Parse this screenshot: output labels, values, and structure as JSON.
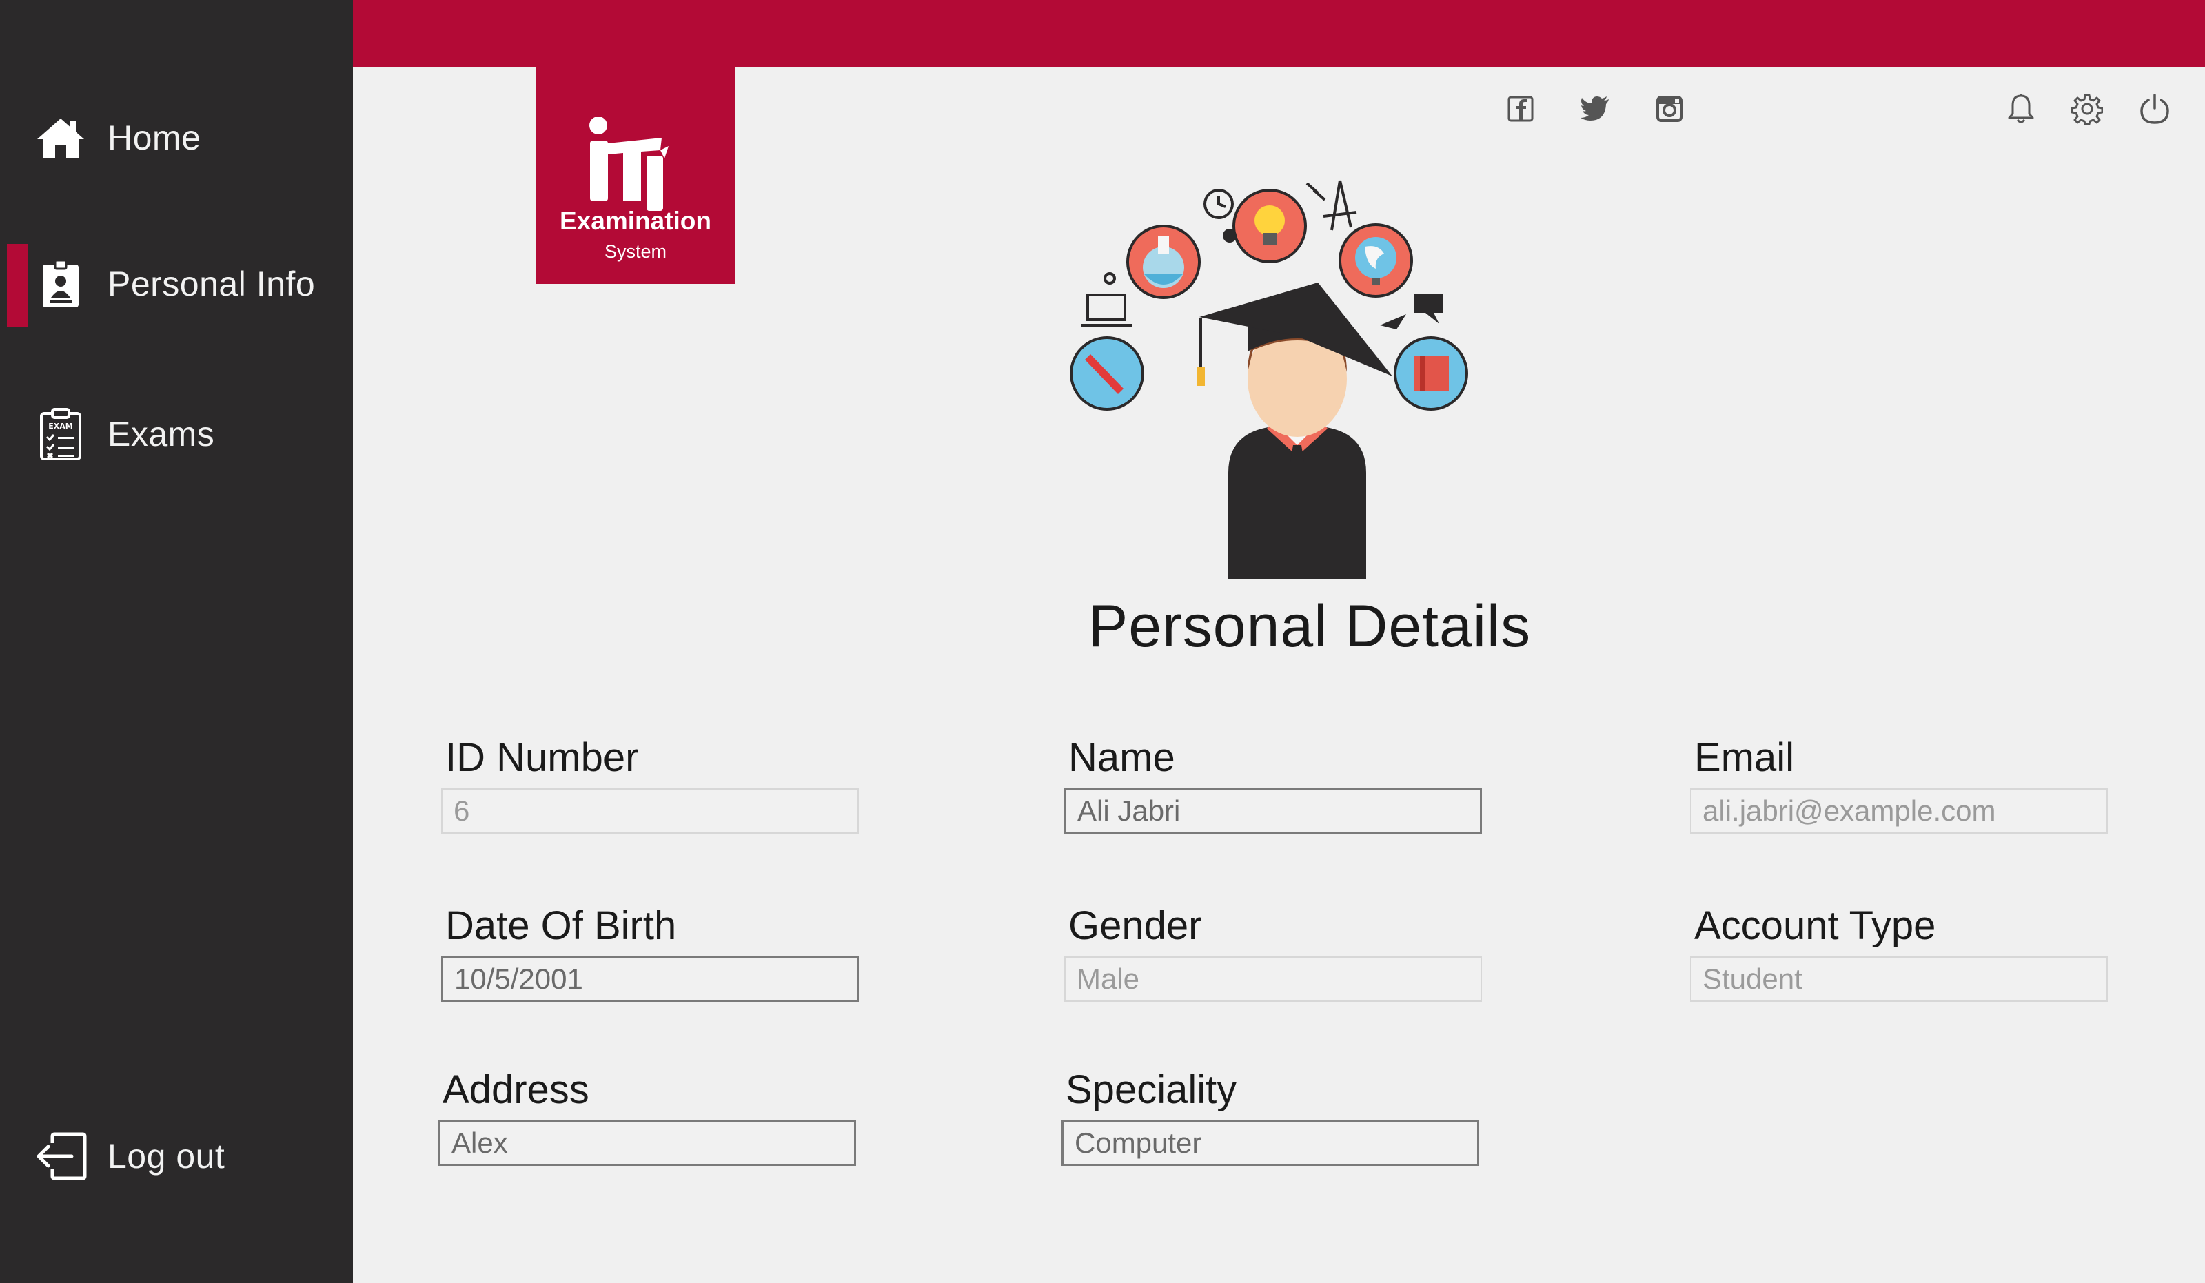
{
  "sidebar": {
    "items": [
      {
        "label": "Home",
        "icon": "home-icon"
      },
      {
        "label": "Personal Info",
        "icon": "id-card-icon",
        "active": true
      },
      {
        "label": "Exams",
        "icon": "exam-clipboard-icon",
        "icon_text": "EXAM"
      }
    ],
    "logout": {
      "label": "Log out",
      "icon": "logout-icon"
    }
  },
  "logo": {
    "title": "Examination",
    "subtitle": "System",
    "mark": "iti"
  },
  "header": {
    "social_icons": [
      "facebook-icon",
      "twitter-icon",
      "instagram-icon"
    ],
    "action_icons": [
      "bell-icon",
      "gear-icon",
      "power-icon"
    ]
  },
  "page": {
    "title": "Personal Details"
  },
  "form": {
    "id_number": {
      "label": "ID Number",
      "value": "6"
    },
    "name": {
      "label": "Name",
      "value": "Ali Jabri"
    },
    "email": {
      "label": "Email",
      "value": "ali.jabri@example.com"
    },
    "dob": {
      "label": "Date Of Birth",
      "value": "10/5/2001"
    },
    "gender": {
      "label": "Gender",
      "value": "Male"
    },
    "account_type": {
      "label": "Account Type",
      "value": "Student"
    },
    "address": {
      "label": "Address",
      "value": "Alex"
    },
    "speciality": {
      "label": "Speciality",
      "value": "Computer"
    }
  },
  "colors": {
    "brand": "#b30a36",
    "sidebar": "#2b292a",
    "background": "#f0f0f0"
  }
}
